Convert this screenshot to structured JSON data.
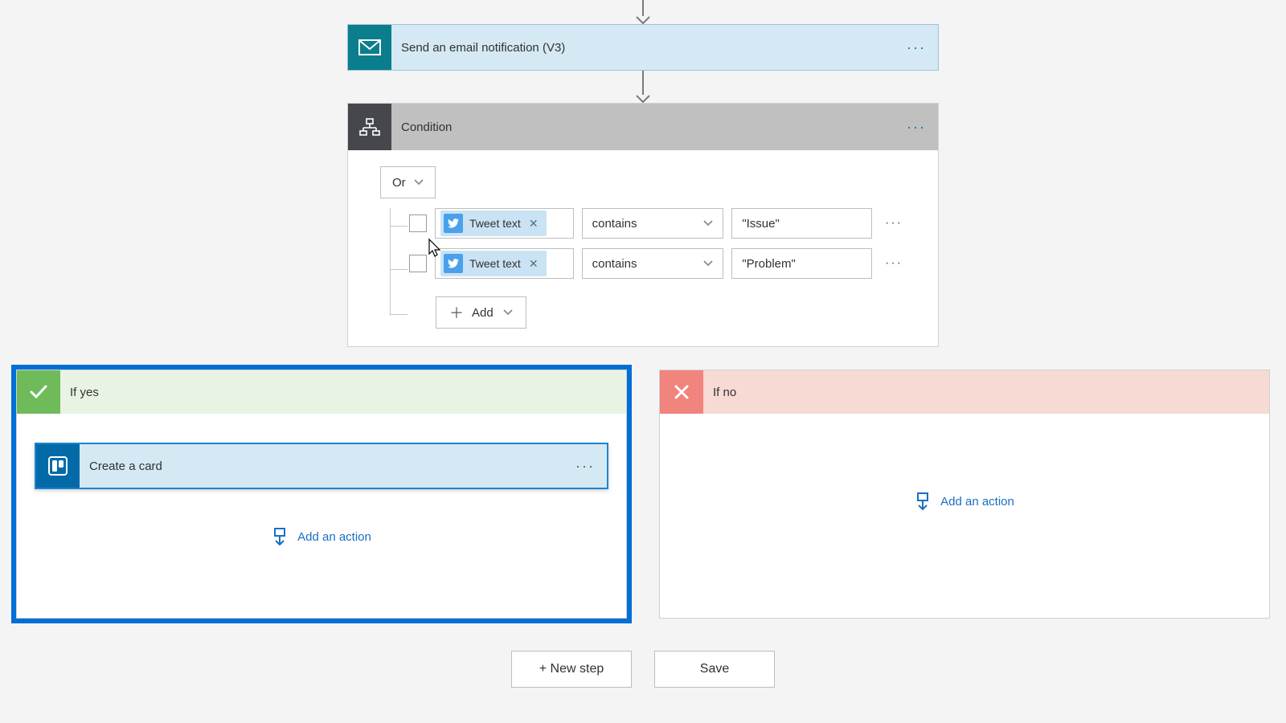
{
  "steps": {
    "email": {
      "title": "Send an email notification (V3)"
    },
    "condition": {
      "title": "Condition",
      "group_operator": "Or",
      "add_label": "Add",
      "rows": [
        {
          "token": "Tweet text",
          "operator": "contains",
          "value": "\"Issue\""
        },
        {
          "token": "Tweet text",
          "operator": "contains",
          "value": "\"Problem\""
        }
      ]
    }
  },
  "branches": {
    "yes": {
      "title": "If yes",
      "actions": [
        {
          "title": "Create a card"
        }
      ],
      "add_action_label": "Add an action"
    },
    "no": {
      "title": "If no",
      "add_action_label": "Add an action"
    }
  },
  "footer": {
    "new_step": "+ New step",
    "save": "Save"
  }
}
